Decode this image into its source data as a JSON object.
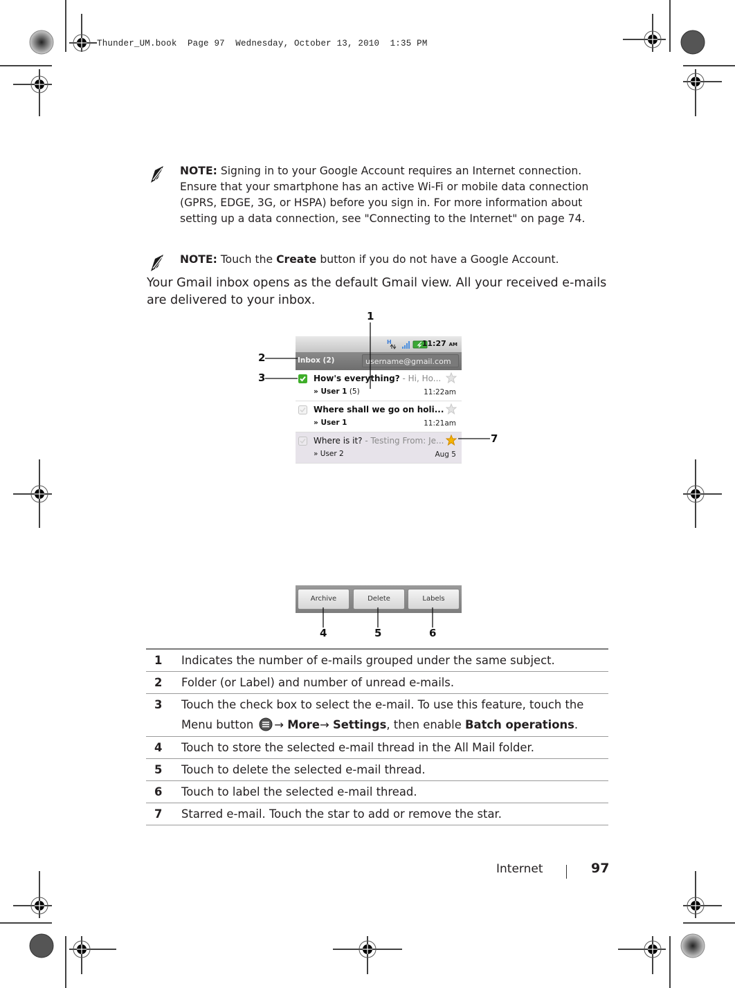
{
  "print_header": {
    "book": "Thunder_UM.book",
    "page": "Page 97",
    "date": "Wednesday, October 13, 2010",
    "time": "1:35 PM"
  },
  "notes": [
    {
      "icon": "pen-note-icon",
      "label": "NOTE:",
      "text": "Signing in to your Google Account requires an Internet connection. Ensure that your smartphone has an active Wi-Fi or mobile data connection (GPRS, EDGE, 3G, or HSPA) before you sign in. For more information about setting up a data connection, see \"Connecting to the Internet\" on page 74."
    },
    {
      "icon": "pen-note-icon",
      "label": "NOTE:",
      "text_before": "Touch the",
      "bold_word": "Create",
      "text_after": "button if you do not have a Google Account."
    }
  ],
  "intro_paragraph": "Your Gmail inbox opens as the default Gmail view. All your received e-mails are delivered to your inbox.",
  "phone": {
    "status_bar": {
      "network": "H",
      "time": "11:27",
      "ampm": "AM"
    },
    "title_bar": {
      "folder": "Inbox (2)",
      "account": "username@gmail.com"
    },
    "emails": [
      {
        "subject": "How's everything?",
        "snippet": " - Hi, Ho...",
        "from": "» User 1",
        "count": " (5)",
        "date": "11:22am",
        "checked": true,
        "starred": false,
        "unread": true
      },
      {
        "subject": "Where shall we go on holi...",
        "snippet": "",
        "from": "» User 1",
        "count": "",
        "date": "11:21am",
        "checked": false,
        "starred": false,
        "unread": true
      },
      {
        "subject": "Where is it?",
        "snippet": " - Testing From: Je...",
        "from": "» User 2",
        "count": "",
        "date": "Aug 5",
        "checked": false,
        "starred": true,
        "unread": false
      }
    ],
    "action_buttons": [
      "Archive",
      "Delete",
      "Labels"
    ]
  },
  "callouts": [
    "1",
    "2",
    "3",
    "4",
    "5",
    "6",
    "7"
  ],
  "legend": [
    {
      "num": "1",
      "desc": "Indicates the number of e-mails grouped under the same subject."
    },
    {
      "num": "2",
      "desc": "Folder (or Label) and number of unread e-mails."
    },
    {
      "num": "3",
      "desc_line1": "Touch the check box to select the e-mail. To use this feature, touch the",
      "desc_menu": "Menu button",
      "arrow": "→",
      "more": "More",
      "settings": "Settings",
      "desc_then": ", then enable ",
      "batch": "Batch operations",
      "period": "."
    },
    {
      "num": "4",
      "desc": "Touch to store the selected e-mail thread in the All Mail folder."
    },
    {
      "num": "5",
      "desc": "Touch to delete the selected e-mail thread."
    },
    {
      "num": "6",
      "desc": "Touch to label the selected e-mail thread."
    },
    {
      "num": "7",
      "desc": "Starred e-mail. Touch the star to add or remove the star."
    }
  ],
  "footer": {
    "section": "Internet",
    "page_number": "97"
  },
  "colors": {
    "check_green": "#3fae2a",
    "star_gold": "#f5b400"
  }
}
